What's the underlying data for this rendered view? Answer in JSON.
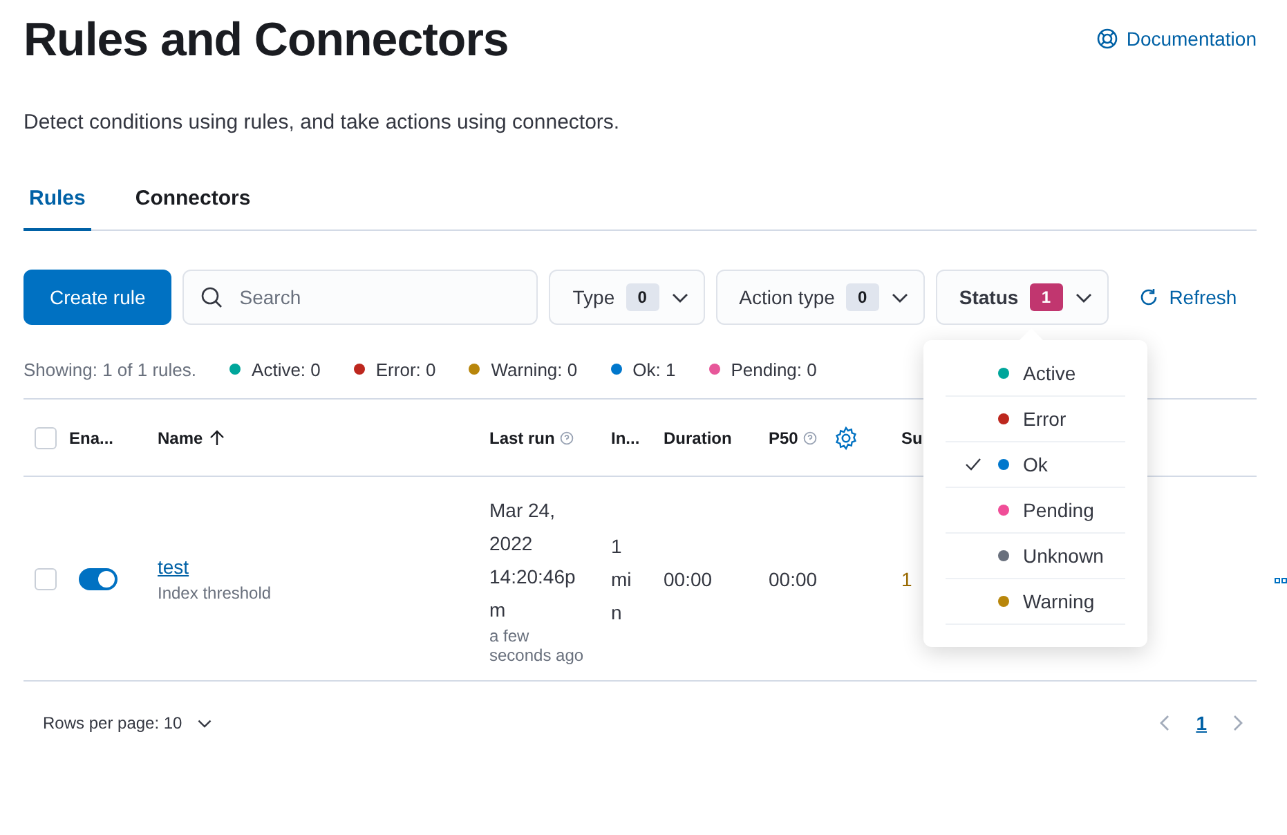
{
  "header": {
    "title": "Rules and Connectors",
    "doc_link": "Documentation",
    "description": "Detect conditions using rules, and take actions using connectors."
  },
  "tabs": [
    {
      "label": "Rules",
      "selected": true
    },
    {
      "label": "Connectors",
      "selected": false
    }
  ],
  "toolbar": {
    "create_button": "Create rule",
    "search": {
      "placeholder": "Search"
    },
    "filters": [
      {
        "label": "Type",
        "count": "0",
        "active": false
      },
      {
        "label": "Action type",
        "count": "0",
        "active": false
      },
      {
        "label": "Status",
        "count": "1",
        "active": true
      }
    ],
    "refresh": "Refresh"
  },
  "summary": {
    "showing": "Showing: 1 of 1 rules.",
    "statuses": [
      {
        "label": "Active: 0",
        "color": "#00a69b"
      },
      {
        "label": "Error: 0",
        "color": "#bd271e"
      },
      {
        "label": "Warning: 0",
        "color": "#b8860b"
      },
      {
        "label": "Ok: 1",
        "color": "#0077cc"
      },
      {
        "label": "Pending: 0",
        "color": "#e7579a"
      }
    ]
  },
  "table": {
    "select_all_checked": false,
    "columns": [
      "Ena...",
      "Name",
      "Last run",
      "In...",
      "Duration",
      "P50",
      "Su"
    ],
    "rows": [
      {
        "checked": false,
        "enabled": true,
        "name": "test",
        "type": "Index threshold",
        "last_run": "Mar 24, 2022 14:20:46pm",
        "last_run_relative": "a few seconds ago",
        "interval": "1 min",
        "duration": "00:00",
        "p50": "00:00",
        "column_7": "1"
      }
    ]
  },
  "status_popover": {
    "items": [
      {
        "label": "Active",
        "color": "#00a69b",
        "selected": false
      },
      {
        "label": "Error",
        "color": "#bd271e",
        "selected": false
      },
      {
        "label": "Ok",
        "color": "#0077cc",
        "selected": true
      },
      {
        "label": "Pending",
        "color": "#f04e98",
        "selected": false
      },
      {
        "label": "Unknown",
        "color": "#69707d",
        "selected": false
      },
      {
        "label": "Warning",
        "color": "#b8860b",
        "selected": false
      }
    ]
  },
  "pagination": {
    "rows_per_page": "Rows per page: 10",
    "pages": [
      {
        "label": "1",
        "selected": true
      }
    ]
  }
}
